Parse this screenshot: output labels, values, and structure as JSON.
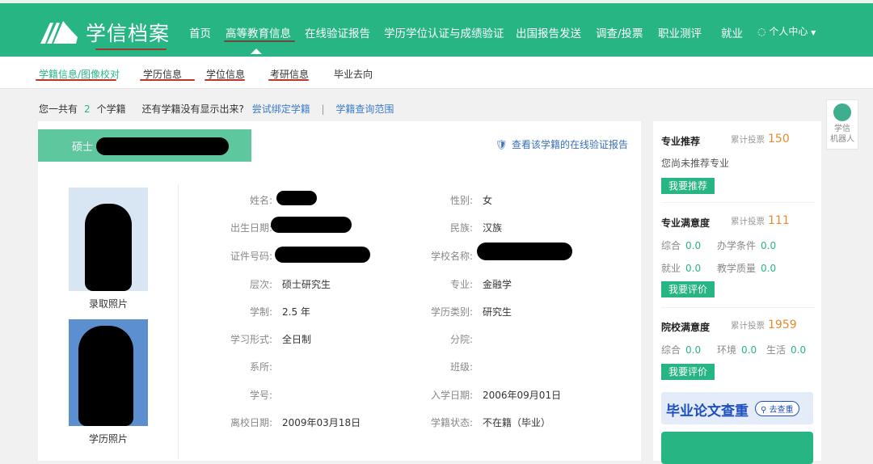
{
  "header": {
    "logo": "学信档案",
    "nav": [
      "首页",
      "高等教育信息",
      "在线验证报告",
      "学历学位认证与成绩验证",
      "出国报告发送",
      "调查/投票",
      "职业测评",
      "就业"
    ],
    "user_menu": "个人中心"
  },
  "subnav": [
    "学籍信息/图像校对",
    "学历信息",
    "学位信息",
    "考研信息",
    "毕业去向"
  ],
  "info": {
    "prefix": "您一共有",
    "count": "2",
    "suffix": "个学籍",
    "question": "还有学籍没有显示出来?",
    "bind_link": "尝试绑定学籍",
    "sep": "|",
    "scope_link": "学籍查询范围"
  },
  "record": {
    "tab_label": "硕士",
    "verify_link": "查看该学籍的在线验证报告",
    "photo1_label": "录取照片",
    "photo2_label": "学历照片",
    "left": [
      {
        "label": "姓名:",
        "value": ""
      },
      {
        "label": "出生日期:",
        "value": ""
      },
      {
        "label": "证件号码:",
        "value": ""
      },
      {
        "label": "层次:",
        "value": "硕士研究生"
      },
      {
        "label": "学制:",
        "value": "2.5 年"
      },
      {
        "label": "学习形式:",
        "value": "全日制"
      },
      {
        "label": "系所:",
        "value": ""
      },
      {
        "label": "学号:",
        "value": ""
      },
      {
        "label": "离校日期:",
        "value": "2009年03月18日"
      }
    ],
    "right": [
      {
        "label": "性别:",
        "value": "女"
      },
      {
        "label": "民族:",
        "value": "汉族"
      },
      {
        "label": "学校名称:",
        "value": ""
      },
      {
        "label": "专业:",
        "value": "金融学"
      },
      {
        "label": "学历类别:",
        "value": "研究生"
      },
      {
        "label": "分院:",
        "value": ""
      },
      {
        "label": "班级:",
        "value": ""
      },
      {
        "label": "入学日期:",
        "value": "2006年09月01日"
      },
      {
        "label": "学籍状态:",
        "value": "不在籍（毕业）"
      }
    ]
  },
  "sidebar": {
    "votes_label": "累计投票",
    "recommend": {
      "title": "专业推荐",
      "votes": "150",
      "text": "您尚未推荐专业",
      "button": "我要推荐"
    },
    "major": {
      "title": "专业满意度",
      "votes": "111",
      "scores": [
        {
          "k": "综合",
          "v": "0.0"
        },
        {
          "k": "办学条件",
          "v": "0.0"
        },
        {
          "k": "就业",
          "v": "0.0"
        },
        {
          "k": "教学质量",
          "v": "0.0"
        }
      ],
      "button": "我要评价"
    },
    "school": {
      "title": "院校满意度",
      "votes": "1959",
      "scores": [
        {
          "k": "综合",
          "v": "0.0"
        },
        {
          "k": "环境",
          "v": "0.0"
        },
        {
          "k": "生活",
          "v": "0.0"
        }
      ],
      "button": "我要评价"
    },
    "banner": {
      "title": "毕业论文查重",
      "button": "去查重"
    }
  },
  "robot": {
    "label1": "学信",
    "label2": "机器人"
  },
  "colors": {
    "brand": "#27b584",
    "tab": "#5fc79e",
    "link": "#3a7bc8",
    "votes": "#e98a2c"
  }
}
